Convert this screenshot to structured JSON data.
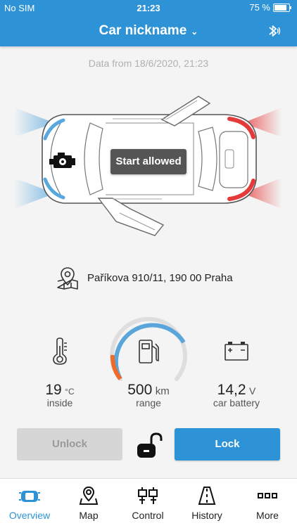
{
  "status_bar": {
    "carrier": "No SIM",
    "time": "21:23",
    "battery": "75 %"
  },
  "header": {
    "title": "Car nickname",
    "chevron_icon": "chevron-down-icon",
    "bluetooth_icon": "bluetooth-icon"
  },
  "data_from": "Data from 18/6/2020, 21:23",
  "car": {
    "start_status": "Start allowed"
  },
  "location": {
    "address": "Paříkova 910/11, 190 00 Praha"
  },
  "stats": {
    "temperature": {
      "value": "19",
      "unit": "°C",
      "label": "inside"
    },
    "range": {
      "value": "500",
      "unit": "km",
      "label": "range"
    },
    "battery": {
      "value": "14,2",
      "unit": "V",
      "label": "car battery"
    }
  },
  "actions": {
    "unlock": "Unlock",
    "lock": "Lock"
  },
  "tabs": [
    {
      "label": "Overview",
      "icon": "car-overview-icon",
      "active": true
    },
    {
      "label": "Map",
      "icon": "map-pin-icon",
      "active": false
    },
    {
      "label": "Control",
      "icon": "control-icon",
      "active": false
    },
    {
      "label": "History",
      "icon": "road-icon",
      "active": false
    },
    {
      "label": "More",
      "icon": "more-dots-icon",
      "active": false
    }
  ],
  "colors": {
    "accent": "#2e93d6",
    "front_glow": "#58a8e0",
    "rear_glow": "#e53a3a",
    "fuel_low": "#f06a2a"
  }
}
